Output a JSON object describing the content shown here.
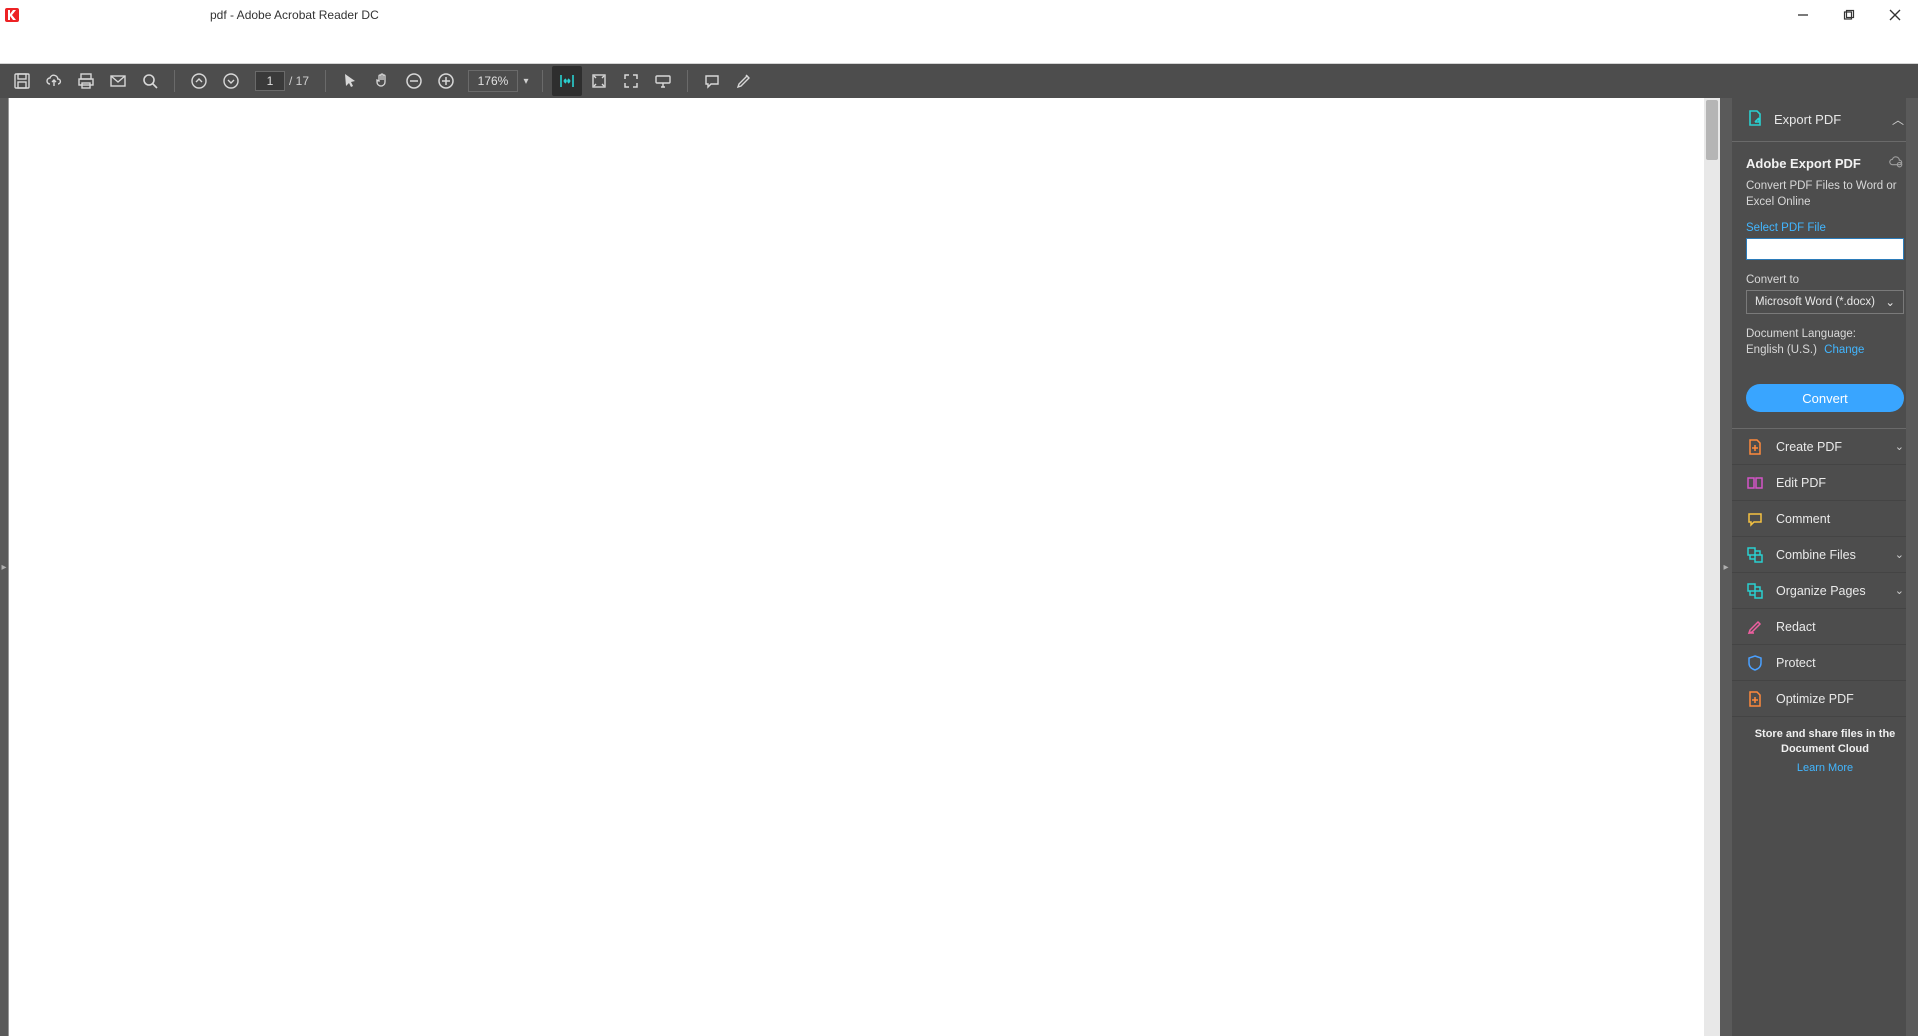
{
  "titlebar": {
    "caption": "pdf - Adobe Acrobat Reader DC"
  },
  "toolbar": {
    "page_current": "1",
    "page_total": "/ 17",
    "zoom": "176%"
  },
  "tools": {
    "export": {
      "header": "Export PDF",
      "title": "Adobe Export PDF",
      "desc": "Convert PDF Files to Word or Excel Online",
      "select_label": "Select PDF File",
      "convert_to_label": "Convert to",
      "convert_to_value": "Microsoft Word (*.docx)",
      "lang_label": "Document Language:",
      "lang_value": "English (U.S.)",
      "lang_change": "Change",
      "button": "Convert"
    },
    "rows": [
      {
        "label": "Create PDF",
        "chev": true,
        "color": "orange"
      },
      {
        "label": "Edit PDF",
        "chev": false,
        "color": "magenta"
      },
      {
        "label": "Comment",
        "chev": false,
        "color": "yellow"
      },
      {
        "label": "Combine Files",
        "chev": true,
        "color": "cyan"
      },
      {
        "label": "Organize Pages",
        "chev": true,
        "color": "cyan"
      },
      {
        "label": "Redact",
        "chev": false,
        "color": "pink"
      },
      {
        "label": "Protect",
        "chev": false,
        "color": "blue"
      },
      {
        "label": "Optimize PDF",
        "chev": false,
        "color": "orange"
      }
    ],
    "promo": {
      "line1": "Store and share files in the",
      "line2": "Document Cloud",
      "link": "Learn More"
    }
  }
}
